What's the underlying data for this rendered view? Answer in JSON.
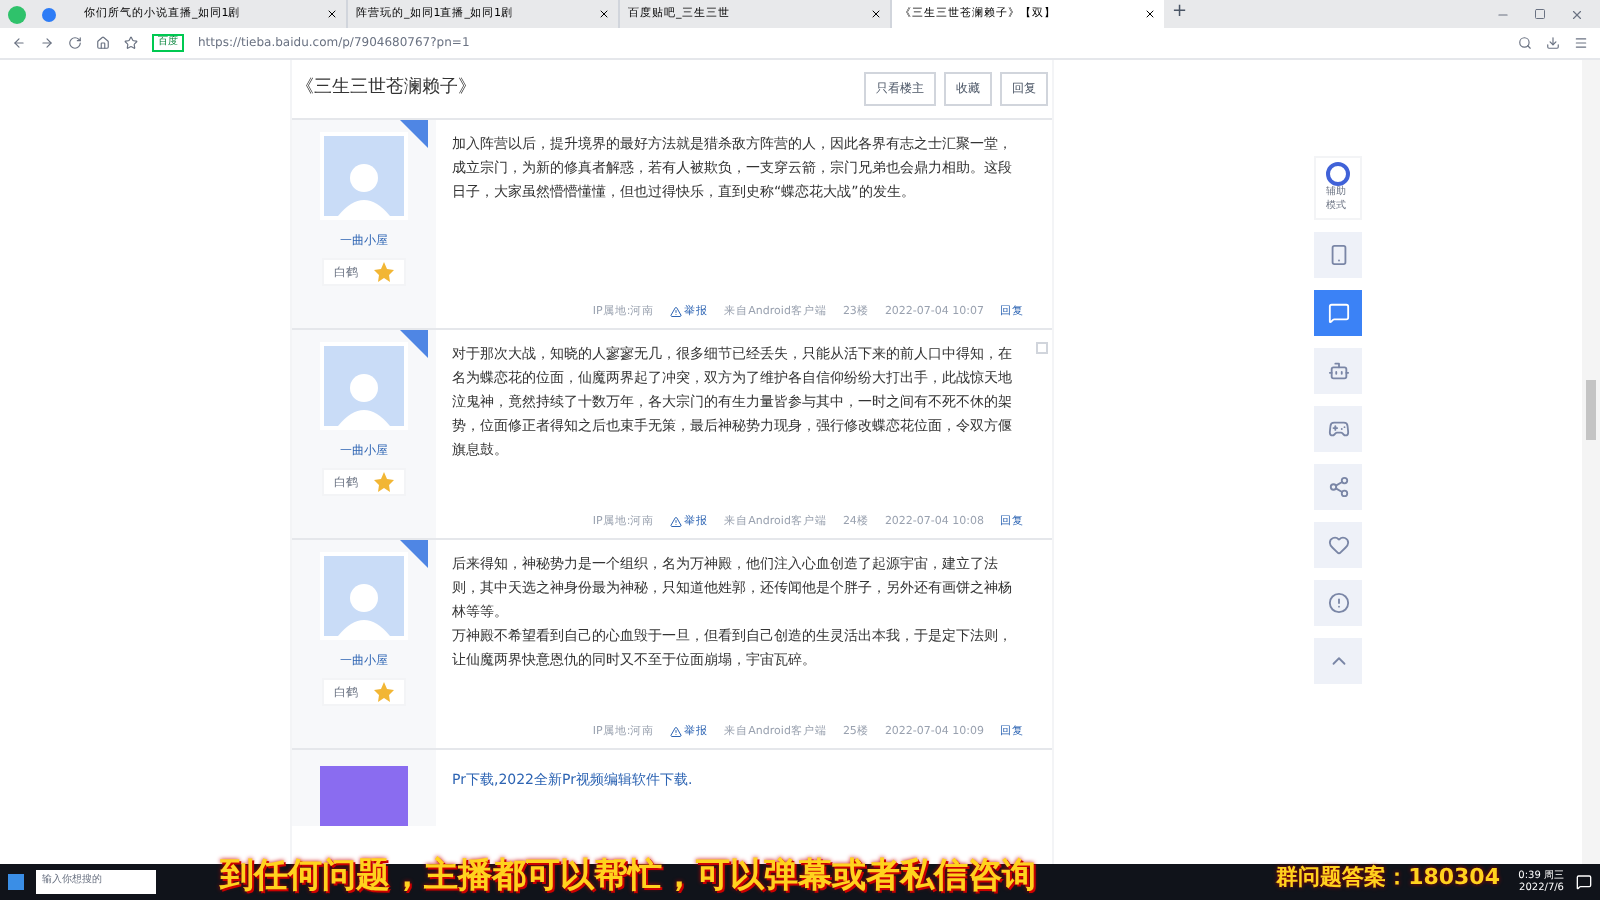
{
  "browser": {
    "tabs": [
      {
        "title": "你们所气的小说直播_如同1剧",
        "selected": false
      },
      {
        "title": "阵营玩的_如同1直播_如同1剧",
        "selected": false
      },
      {
        "title": "百度贴吧_三生三世",
        "selected": false
      },
      {
        "title": "《三生三世苍澜赖子》【双】",
        "selected": true
      }
    ],
    "new_tab": "+",
    "security_label": "百度",
    "url": "https://tieba.baidu.com/p/7904680767?pn=1"
  },
  "thread": {
    "title": "《三生三世苍澜赖子》",
    "actions": [
      "只看楼主",
      "收藏",
      "回复"
    ]
  },
  "posts": [
    {
      "user": "一曲小屋",
      "badge": "白鹤",
      "paragraphs": [
        "加入阵营以后，提升境界的最好方法就是猎杀敌方阵营的人，因此各界有志之士汇聚一堂，成立宗门，为新的修真者解惑，若有人被欺负，一支穿云箭，宗门兄弟也会鼎力相助。这段日子，大家虽然懵懵懂懂，但也过得快乐，直到史称“蝶恋花大战”的发生。"
      ],
      "ip": "IP属地:河南",
      "report": "举报",
      "source": "来自Android客户端",
      "floor": "23楼",
      "time": "2022-07-04 10:07",
      "reply": "回复"
    },
    {
      "user": "一曲小屋",
      "badge": "白鹤",
      "paragraphs": [
        "对于那次大战，知晓的人寥寥无几，很多细节已经丢失，只能从活下来的前人口中得知，在名为蝶恋花的位面，仙魔两界起了冲突，双方为了维护各自信仰纷纷大打出手，此战惊天地泣鬼神，竟然持续了十数万年，各大宗门的有生力量皆参与其中，一时之间有不死不休的架势，位面修正者得知之后也束手无策，最后神秘势力现身，强行修改蝶恋花位面，令双方偃旗息鼓。"
      ],
      "ip": "IP属地:河南",
      "report": "举报",
      "source": "来自Android客户端",
      "floor": "24楼",
      "time": "2022-07-04 10:08",
      "reply": "回复"
    },
    {
      "user": "一曲小屋",
      "badge": "白鹤",
      "paragraphs": [
        "后来得知，神秘势力是一个组织，名为万神殿，他们注入心血创造了起源宇宙，建立了法则，其中天选之神身份最为神秘，只知道他姓郭，还传闻他是个胖子，另外还有画饼之神杨林等等。",
        "万神殿不希望看到自己的心血毁于一旦，但看到自己创造的生灵活出本我，于是定下法则，让仙魔两界快意恩仇的同时又不至于位面崩塌，宇宙瓦碎。"
      ],
      "ip": "IP属地:河南",
      "report": "举报",
      "source": "来自Android客户端",
      "floor": "25楼",
      "time": "2022-07-04 10:09",
      "reply": "回复"
    }
  ],
  "ad_link": "Pr下载,2022全新Pr视频编辑软件下载.",
  "side_tools": {
    "assist_label": "辅助模式"
  },
  "overlay": {
    "subtitle": "到任何问题，主播都可以帮忙，可以弹幕或者私信咨询",
    "answer": "群问题答案：180304"
  },
  "taskbar": {
    "search_placeholder": "输入你想搜的",
    "time": "0:39 周三",
    "date": "2022/7/6"
  }
}
